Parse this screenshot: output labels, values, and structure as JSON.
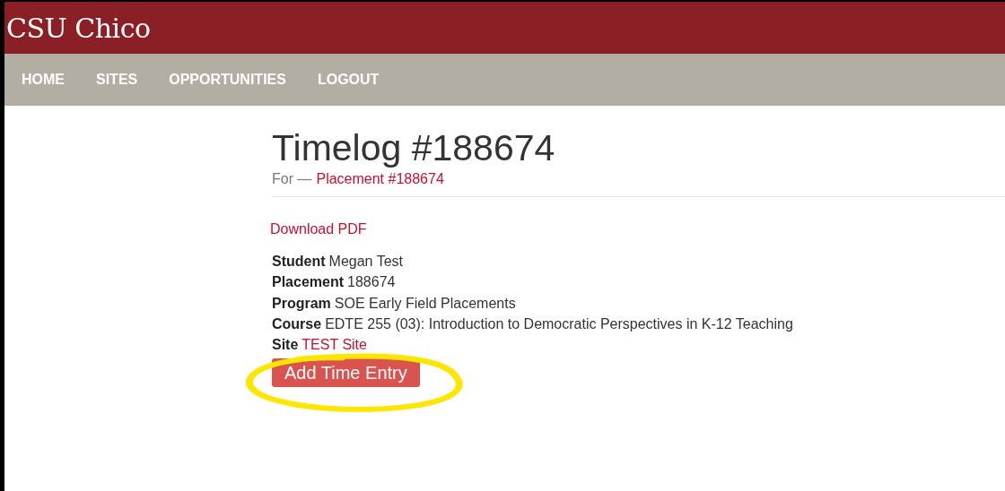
{
  "brand": "CSU Chico",
  "nav": [
    {
      "label": "HOME"
    },
    {
      "label": "SITES"
    },
    {
      "label": "OPPORTUNITIES"
    },
    {
      "label": "LOGOUT"
    }
  ],
  "title": "Timelog #188674",
  "subtitle": {
    "prefix": "For —",
    "link": "Placement #188674"
  },
  "download_link": "Download PDF",
  "details": [
    {
      "label": "Student",
      "value": "Megan Test",
      "kind": "text"
    },
    {
      "label": "Placement",
      "value": "188674",
      "kind": "text"
    },
    {
      "label": "Program",
      "value": "SOE Early Field Placements",
      "kind": "text"
    },
    {
      "label": "Course",
      "value": "EDTE 255 (03): Introduction to Democratic Perspectives in K-12 Teaching",
      "kind": "text"
    },
    {
      "label": "Site",
      "value": "TEST Site",
      "kind": "link"
    }
  ],
  "button": "Add Time Entry",
  "annotation": {
    "kind": "circle"
  }
}
